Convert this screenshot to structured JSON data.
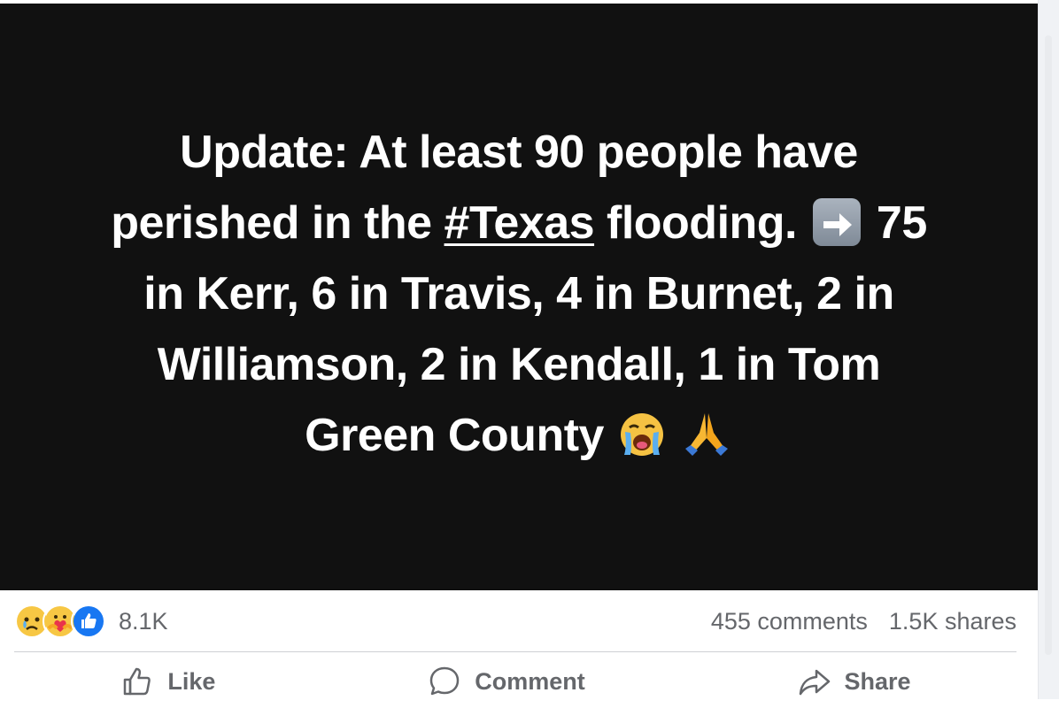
{
  "post": {
    "media_text": {
      "line1": "Update: At least 90 people have",
      "line2_pre": "perished in the ",
      "hashtag": "#Texas",
      "line2_post": " flooding.",
      "line2_tail": "75",
      "line3": "in Kerr, 6 in Travis, 4 in Burnet, 2 in",
      "line4": "Williamson, 2 in Kendall, 1 in Tom",
      "line5": "Green County"
    },
    "emojis": [
      "right-arrow",
      "loudly-crying-face",
      "folded-hands"
    ],
    "background_color": "#111111"
  },
  "stats": {
    "reactions": [
      "sad",
      "care",
      "like"
    ],
    "reaction_count": "8.1K",
    "comments": "455 comments",
    "shares": "1.5K shares"
  },
  "actions": {
    "like_label": "Like",
    "comment_label": "Comment",
    "share_label": "Share"
  },
  "colors": {
    "like_blue": "#1877f2",
    "text_secondary": "#65676b"
  }
}
